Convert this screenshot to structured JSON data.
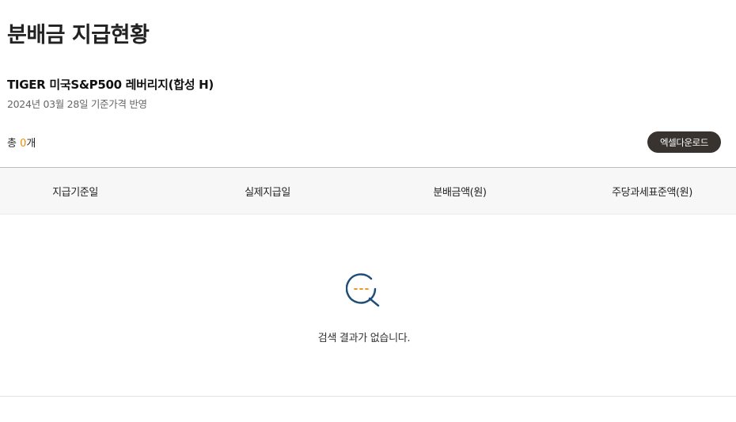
{
  "page": {
    "title": "분배금 지급현황"
  },
  "fund": {
    "name": "TIGER 미국S&P500 레버리지(합성 H)",
    "price_date_note": "2024년 03월 28일 기준가격 반영"
  },
  "summary": {
    "total_prefix": "총 ",
    "total_count": "0",
    "total_suffix": "개"
  },
  "toolbar": {
    "excel_download_label": "엑셀다운로드"
  },
  "table": {
    "columns": [
      "지급기준일",
      "실제지급일",
      "분배금액(원)",
      "주당과세표준액(원)"
    ],
    "rows": []
  },
  "empty_state": {
    "icon": "search-empty-icon",
    "message": "검색 결과가 없습니다."
  },
  "colors": {
    "accent": "#f08c00",
    "button_bg": "#38332f",
    "icon_blue": "#1f4e79",
    "header_bg": "#f7f7f7"
  }
}
